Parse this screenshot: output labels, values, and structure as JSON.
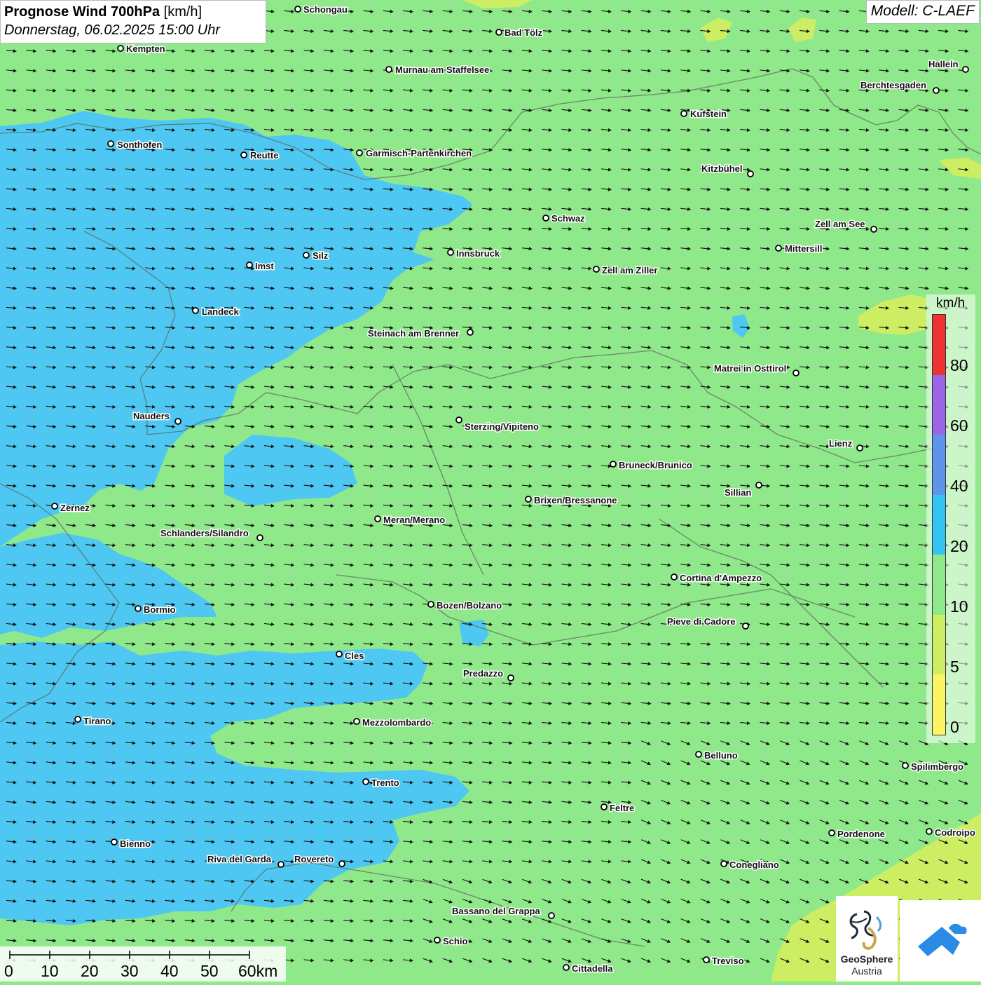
{
  "title": {
    "bold": "Prognose Wind 700hPa",
    "unit": "[km/h]",
    "date": "Donnerstag, 06.02.2025 15:00 Uhr"
  },
  "model_label": "Modell: C-LAEF",
  "legend": {
    "unit": "km/h",
    "labels": [
      "80",
      "60",
      "40",
      "20",
      "10",
      "5",
      "0"
    ],
    "colors": [
      "#ee3333",
      "#9a66e6",
      "#5c95ea",
      "#33c4f2",
      "#8fe88a",
      "#cdee62",
      "#fbf564"
    ]
  },
  "scalebar": {
    "labels": [
      "0",
      "10",
      "20",
      "30",
      "40",
      "50",
      "60km"
    ]
  },
  "logos": {
    "geosphere_line1": "GeoSphere",
    "geosphere_line2": "Austria"
  },
  "colors": {
    "background_green": "#8fe88a",
    "zone_blue": "#4ec8f2",
    "zone_yellow": "#cdee62",
    "arrow": "#111111",
    "app_logo_blue": "#2a8be6"
  },
  "cities": [
    {
      "name": "Schongau"
    },
    {
      "name": "Bad Tölz"
    },
    {
      "name": "Kempten"
    },
    {
      "name": "Murnau am Staffelsee"
    },
    {
      "name": "Hallein"
    },
    {
      "name": "Berchtesgaden"
    },
    {
      "name": "Kufstein"
    },
    {
      "name": "Sonthofen"
    },
    {
      "name": "Reutte"
    },
    {
      "name": "Garmisch-Partenkirchen"
    },
    {
      "name": "Kitzbühel"
    },
    {
      "name": "Schwaz"
    },
    {
      "name": "Zell am See"
    },
    {
      "name": "Mittersill"
    },
    {
      "name": "Innsbruck"
    },
    {
      "name": "Silz"
    },
    {
      "name": "Imst"
    },
    {
      "name": "Zell am Ziller"
    },
    {
      "name": "Landeck"
    },
    {
      "name": "Steinach am Brenner"
    },
    {
      "name": "Matrei in Osttirol"
    },
    {
      "name": "Nauders"
    },
    {
      "name": "Sterzing/Vipiteno"
    },
    {
      "name": "Lienz"
    },
    {
      "name": "Bruneck/Brunico"
    },
    {
      "name": "Sillian"
    },
    {
      "name": "Zernez"
    },
    {
      "name": "Brixen/Bressanone"
    },
    {
      "name": "Meran/Merano"
    },
    {
      "name": "Schlanders/Silandro"
    },
    {
      "name": "Cortina d'Ampezzo"
    },
    {
      "name": "Bormio"
    },
    {
      "name": "Bozen/Bolzano"
    },
    {
      "name": "Pieve di Cadore"
    },
    {
      "name": "Cles"
    },
    {
      "name": "Predazzo"
    },
    {
      "name": "Tirano"
    },
    {
      "name": "Mezzolombardo"
    },
    {
      "name": "Belluno"
    },
    {
      "name": "Spilimbergo"
    },
    {
      "name": "Trento"
    },
    {
      "name": "Feltre"
    },
    {
      "name": "Pordenone"
    },
    {
      "name": "Codroipo"
    },
    {
      "name": "Bienno"
    },
    {
      "name": "Riva del Garda"
    },
    {
      "name": "Rovereto"
    },
    {
      "name": "Conegliano"
    },
    {
      "name": "Bassano del Grappa"
    },
    {
      "name": "Schio"
    },
    {
      "name": "Treviso"
    },
    {
      "name": "Cittadella"
    }
  ]
}
